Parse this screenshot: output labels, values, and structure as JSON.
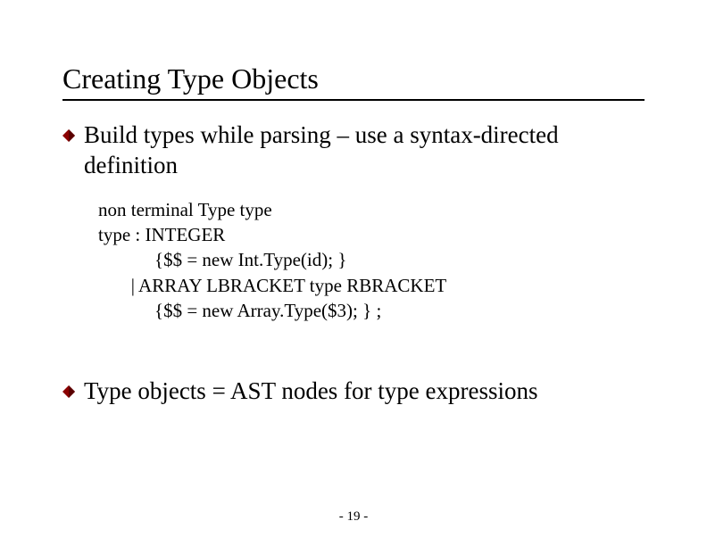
{
  "title": "Creating Type Objects",
  "bullet1": "Build types while parsing – use a syntax-directed definition",
  "code": "non terminal Type type\ntype : INTEGER\n            {$$ = new Int.Type(id); }\n       | ARRAY LBRACKET type RBRACKET\n            {$$ = new Array.Type($3); } ;",
  "bullet2": "Type objects = AST nodes for type expressions",
  "page_number": "- 19 -"
}
